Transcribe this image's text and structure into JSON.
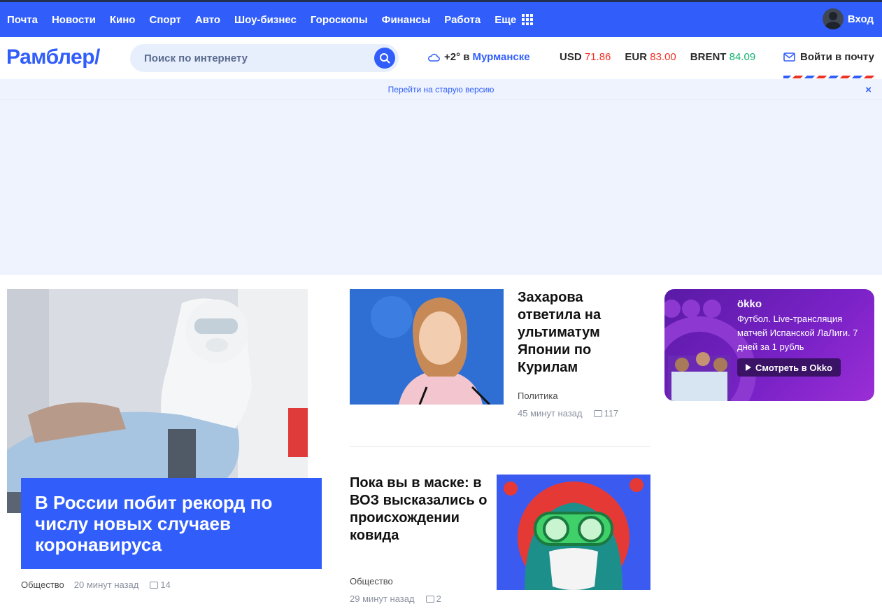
{
  "topnav": {
    "items": [
      "Почта",
      "Новости",
      "Кино",
      "Спорт",
      "Авто",
      "Шоу-бизнес",
      "Гороскопы",
      "Финансы",
      "Работа"
    ],
    "more_label": "Еще",
    "login_label": "Вход"
  },
  "header": {
    "logo": "Рамблер/",
    "search_placeholder": "Поиск по интернету",
    "weather_temp": "+2° в",
    "weather_city": "Мурманске",
    "rates": [
      {
        "name": "USD",
        "value": "71.86",
        "trend": "red"
      },
      {
        "name": "EUR",
        "value": "83.00",
        "trend": "red"
      },
      {
        "name": "BRENT",
        "value": "84.09",
        "trend": "green"
      }
    ],
    "mail_label": "Войти в почту"
  },
  "oldbar": {
    "label": "Перейти на старую версию",
    "close": "×"
  },
  "feature": {
    "title": "В России побит рекорд по числу новых случаев коронавируса",
    "category": "Общество",
    "time": "20 минут назад",
    "comments": "14"
  },
  "article1": {
    "title": "Захарова ответила на ультиматум Японии по Курилам",
    "category": "Политика",
    "time": "45 минут назад",
    "comments": "117"
  },
  "article2": {
    "title": "Пока вы в маске: в ВОЗ высказались о происхождении ковида",
    "category": "Общество",
    "time": "29 минут назад",
    "comments": "2"
  },
  "okko": {
    "logo": "ökko",
    "text": "Футбол. Live-трансляция матчей Испанской ЛаЛиги. 7 дней за 1 рубль",
    "button": "Смотреть в Okko"
  },
  "colors": {
    "brand": "#315efb",
    "rate_red": "#ef3124",
    "rate_green": "#12b36f",
    "okko_purple": "#7a22c7"
  }
}
